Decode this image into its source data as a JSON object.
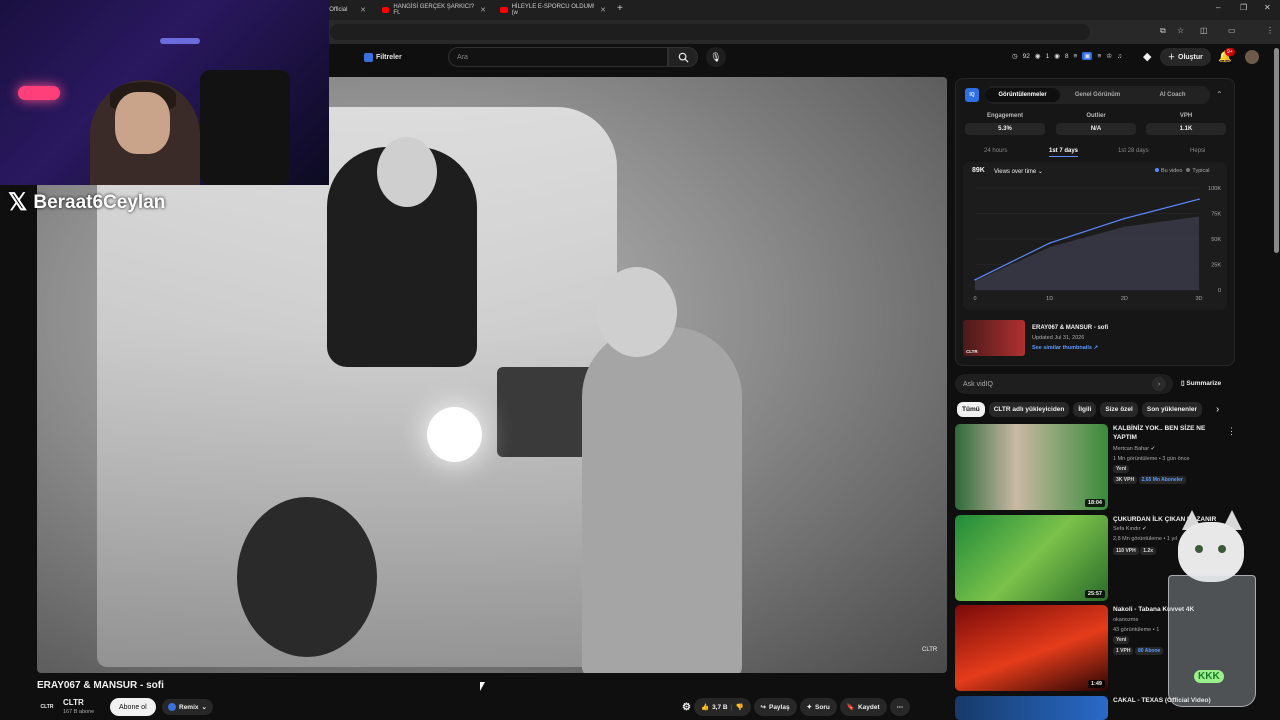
{
  "browser": {
    "tabs": [
      {
        "label": "| Official"
      },
      {
        "label": "HANGİSİ GERÇEK ŞARKICI? Ft."
      },
      {
        "label": "HİLEYLE E-SPORCU OLDUM!(w"
      }
    ],
    "new_tab": "+",
    "window_controls": [
      "–",
      "❐",
      "✕"
    ]
  },
  "streamer": {
    "handle": "Beraat6Ceylan",
    "x_logo": "𝕏"
  },
  "header": {
    "filters_label": "Filtreler",
    "search_placeholder": "Ara",
    "stats": [
      "92",
      "1",
      "8"
    ],
    "create_label": "Oluştur",
    "notif_badge": "9+"
  },
  "video": {
    "title": "ERAY067 & MANSUR - sofi",
    "watermark": "CLTR",
    "channel": {
      "logo_text": "CLTR",
      "name": "CLTR",
      "subs": "167 B abone"
    },
    "subscribe_label": "Abone ol",
    "remix_label": "Remix",
    "likes": "3,7 B",
    "share_label": "Paylaş",
    "ask_label": "Soru",
    "save_label": "Kaydet"
  },
  "vidiq": {
    "logo": "IQ",
    "tabs": [
      {
        "label": "Görüntülenmeler"
      },
      {
        "label": "Genel Görünüm"
      },
      {
        "label": "AI Coach"
      }
    ],
    "metrics": [
      {
        "label": "Engagement",
        "value": "5.3%"
      },
      {
        "label": "Outlier",
        "value": "N/A"
      },
      {
        "label": "VPH",
        "value": "1.1K"
      }
    ],
    "ranges": [
      {
        "label": "24 hours"
      },
      {
        "label": "1st 7 days"
      },
      {
        "label": "1st 28 days"
      },
      {
        "label": "Hepsi"
      }
    ],
    "chart_views": "89K",
    "chart_dropdown": "Views over time",
    "legend": [
      {
        "label": "Bu video",
        "color": "#5a8bff"
      },
      {
        "label": "Typical",
        "color": "#777777"
      }
    ],
    "video_title": "ERAY067 & MANSUR - sofi",
    "updated": "Updated Jul 31, 2026",
    "similar_link": "See similar thumbnails",
    "thumb_badge": "CLTR",
    "ask_placeholder": "Ask vidIQ",
    "summarize_label": "Summarize"
  },
  "chart_data": {
    "type": "area",
    "x": [
      "0",
      "1D",
      "2D",
      "3D"
    ],
    "series": [
      {
        "name": "Bu video",
        "values": [
          10000,
          46000,
          70000,
          89000
        ]
      },
      {
        "name": "Typical",
        "values": [
          9000,
          42000,
          62000,
          72000
        ]
      }
    ],
    "ylim": [
      0,
      100000
    ],
    "yticks": [
      "0",
      "25K",
      "50K",
      "75K",
      "100K"
    ],
    "grid": true,
    "legend": "top-right"
  },
  "chips": [
    {
      "label": "Tümü"
    },
    {
      "label": "CLTR adlı yükleyiciden"
    },
    {
      "label": "İlgili"
    },
    {
      "label": "Size özel"
    },
    {
      "label": "Son yüklenenler"
    }
  ],
  "suggestions": [
    {
      "title": "KALBİNİZ YOK.. BEN SİZE NE YAPTIM",
      "channel": "Mertcan Bahar",
      "meta": "1 Mn görüntüleme • 3 gün önce",
      "new": "Yeni",
      "vph": "3K VPH",
      "extra": "2,65 Mn Aboneler",
      "duration": "18:04"
    },
    {
      "title": "ÇUKURDAN İLK ÇIKAN KAZANIR",
      "channel": "Sefa Kındır",
      "meta": "2,8 Mn görüntüleme • 1 yıl",
      "vph": "110 VPH",
      "extra": "1.2x",
      "duration": "25:57"
    },
    {
      "title": "Nakoli - Tabana Kuvvet 4K",
      "channel": "okanozme",
      "meta": "43 görüntüleme • 1",
      "new": "Yeni",
      "vph": "1 VPH",
      "extra": "80 Abone",
      "duration": "1:49"
    },
    {
      "title": "CAKAL - TEXAS (Official Video)",
      "duration": ""
    }
  ],
  "overlay": {
    "kkk": "KKK"
  }
}
